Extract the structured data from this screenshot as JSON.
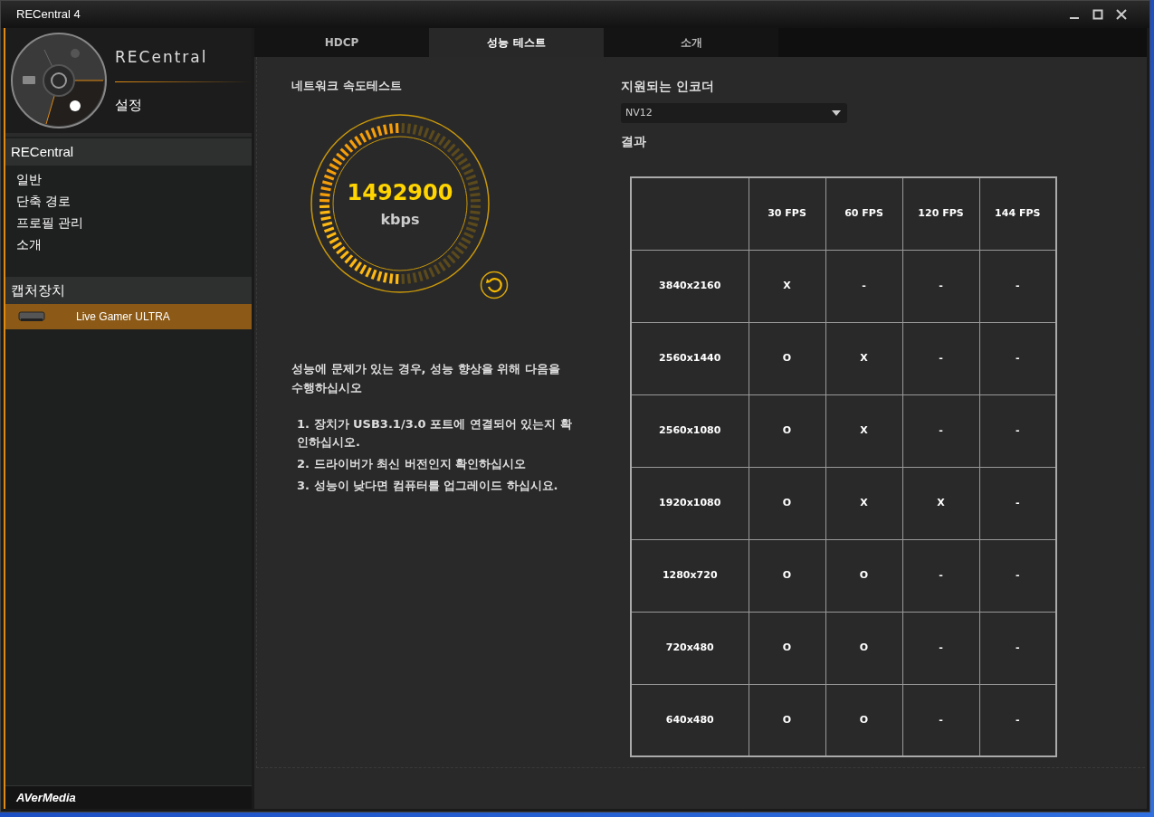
{
  "window": {
    "title": "RECentral 4"
  },
  "sidebar": {
    "logo": "RECentral",
    "current_page": "설정",
    "brand": "AVerMedia",
    "sections": [
      {
        "title": "RECentral",
        "kind": "menu",
        "items": [
          {
            "label": "일반",
            "selected": false
          },
          {
            "label": "단축 경로",
            "selected": false
          },
          {
            "label": "프로필 관리",
            "selected": false
          },
          {
            "label": "소개",
            "selected": false
          }
        ]
      },
      {
        "title": "캡처장치",
        "kind": "devices",
        "items": [
          {
            "label": "Live Gamer ULTRA",
            "selected": true
          }
        ]
      }
    ]
  },
  "tabs": [
    {
      "label": "HDCP",
      "selected": false
    },
    {
      "label": "성능 테스트",
      "selected": true
    },
    {
      "label": "소개",
      "selected": false
    }
  ],
  "speed_test": {
    "title": "네트워크 속도테스트",
    "value": "1492900",
    "unit": "kbps",
    "level": 0.5
  },
  "tips": {
    "intro": "성능에 문제가 있는 경우, 성능 향상을 위해 다음을 수행하십시오",
    "steps": [
      "1. 장치가 USB3.1/3.0 포트에 연결되어 있는지 확인하십시오.",
      "2. 드라이버가 최신 버전인지 확인하십시오",
      "3. 성능이 낮다면 컴퓨터를 업그레이드 하십시요."
    ]
  },
  "encoder": {
    "label": "지원되는 인코더",
    "value": "NV12"
  },
  "results": {
    "title": "결과",
    "columns": [
      "30 FPS",
      "60 FPS",
      "120 FPS",
      "144 FPS"
    ],
    "rows": [
      {
        "resolution": "3840x2160",
        "cells": [
          "X",
          "-",
          "-",
          "-"
        ]
      },
      {
        "resolution": "2560x1440",
        "cells": [
          "O",
          "X",
          "-",
          "-"
        ]
      },
      {
        "resolution": "2560x1080",
        "cells": [
          "O",
          "X",
          "-",
          "-"
        ]
      },
      {
        "resolution": "1920x1080",
        "cells": [
          "O",
          "X",
          "X",
          "-"
        ]
      },
      {
        "resolution": "1280x720",
        "cells": [
          "O",
          "O",
          "-",
          "-"
        ]
      },
      {
        "resolution": "720x480",
        "cells": [
          "O",
          "O",
          "-",
          "-"
        ]
      },
      {
        "resolution": "640x480",
        "cells": [
          "O",
          "O",
          "-",
          "-"
        ]
      }
    ]
  }
}
